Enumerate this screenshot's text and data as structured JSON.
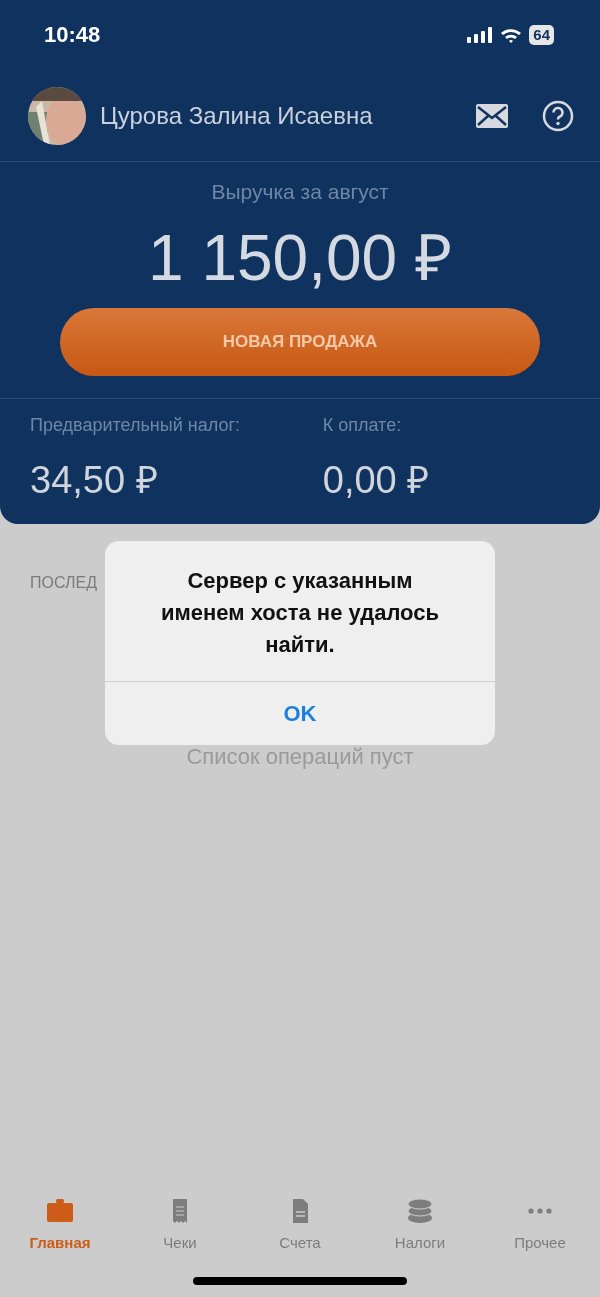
{
  "status_bar": {
    "time": "10:48",
    "battery": "64"
  },
  "profile": {
    "name": "Цурова Залина Исаевна"
  },
  "revenue": {
    "label": "Выручка за август",
    "amount": "1 150,00 ₽"
  },
  "new_sale_button": "НОВАЯ ПРОДАЖА",
  "summary": [
    {
      "label": "Предварительный налог:",
      "value": "34,50 ₽"
    },
    {
      "label": "К оплате:",
      "value": "0,00 ₽"
    }
  ],
  "recent_heading": "ПОСЛЕД",
  "empty_message": "Список операций пуст",
  "alert": {
    "message": "Сервер с указанным именем хоста не удалось найти.",
    "button": "OK"
  },
  "tabs": [
    {
      "label": "Главная",
      "kind": "briefcase",
      "selected": true
    },
    {
      "label": "Чеки",
      "kind": "receipt",
      "selected": false
    },
    {
      "label": "Счета",
      "kind": "document",
      "selected": false
    },
    {
      "label": "Налоги",
      "kind": "coins",
      "selected": false
    },
    {
      "label": "Прочее",
      "kind": "more",
      "selected": false
    }
  ]
}
